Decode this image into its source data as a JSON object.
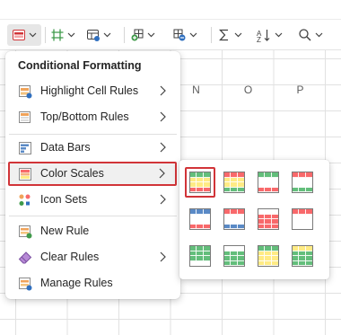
{
  "toolbar": {
    "items": [
      {
        "name": "conditional-formatting-icon",
        "active": true
      },
      {
        "name": "table-format-icon"
      },
      {
        "name": "cell-styles-icon"
      },
      {
        "name": "insert-cells-icon"
      },
      {
        "name": "delete-cells-icon"
      },
      {
        "name": "autosum-icon"
      },
      {
        "name": "sort-filter-icon"
      },
      {
        "name": "find-icon"
      }
    ]
  },
  "columns": [
    "N",
    "O",
    "P"
  ],
  "menu": {
    "title": "Conditional Formatting",
    "items": [
      {
        "label": "Highlight Cell Rules",
        "icon": "highlight-cells-icon",
        "submenu": true
      },
      {
        "label": "Top/Bottom Rules",
        "icon": "top-bottom-icon",
        "submenu": true
      },
      {
        "label": "Data Bars",
        "icon": "data-bars-icon",
        "submenu": true
      },
      {
        "label": "Color Scales",
        "icon": "color-scales-icon",
        "submenu": true,
        "selected": true
      },
      {
        "label": "Icon Sets",
        "icon": "icon-sets-icon",
        "submenu": true
      },
      {
        "label": "New Rule",
        "icon": "new-rule-icon",
        "submenu": false
      },
      {
        "label": "Clear Rules",
        "icon": "eraser-icon",
        "submenu": true
      },
      {
        "label": "Manage Rules",
        "icon": "manage-rules-icon",
        "submenu": false
      }
    ]
  },
  "color_scales": {
    "selected_index": 0,
    "swatches": [
      [
        "#63be7b",
        "#ffeb84",
        "#f8696b"
      ],
      [
        "#f8696b",
        "#ffeb84",
        "#63be7b"
      ],
      [
        "#63be7b",
        "#ffffff",
        "#f8696b"
      ],
      [
        "#f8696b",
        "#ffffff",
        "#63be7b"
      ],
      [
        "#5a8ac6",
        "#ffffff",
        "#f8696b"
      ],
      [
        "#f8696b",
        "#ffffff",
        "#5a8ac6"
      ],
      [
        "#ffffff",
        "#f8696b",
        "#f8696b"
      ],
      [
        "#f8696b",
        "#ffffff",
        "#ffffff"
      ],
      [
        "#63be7b",
        "#63be7b",
        "#ffffff"
      ],
      [
        "#ffffff",
        "#63be7b",
        "#63be7b"
      ],
      [
        "#63be7b",
        "#ffeb84",
        "#ffeb84"
      ],
      [
        "#ffeb84",
        "#63be7b",
        "#63be7b"
      ]
    ]
  },
  "colors": {
    "accent_red": "#d13438",
    "icon_blue": "#2f6fbf",
    "icon_green": "#3f9a4a"
  }
}
